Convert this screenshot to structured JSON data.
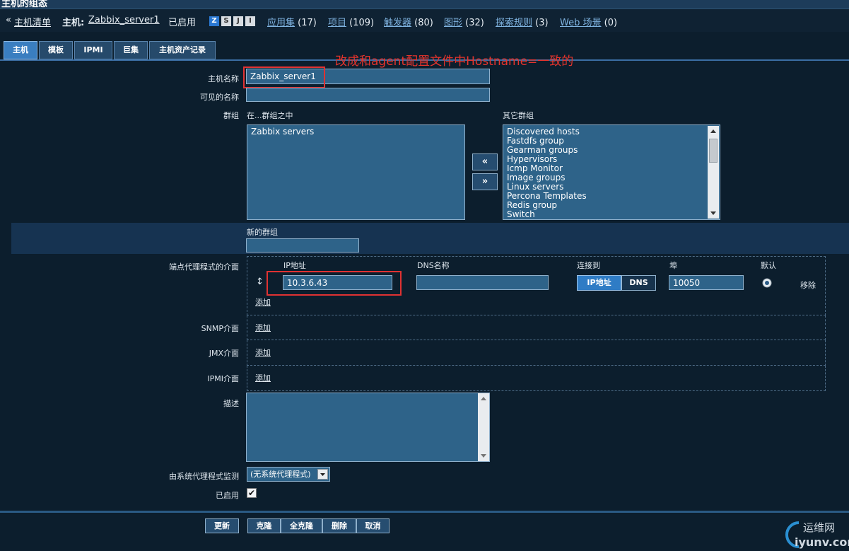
{
  "title": "主机的组态",
  "nav": {
    "back_glyph": "«",
    "host_list": "主机清单",
    "host_prefix": "主机:",
    "host_name": "Zabbix_server1",
    "status": "已启用",
    "badges": [
      "Z",
      "S",
      "J",
      "I"
    ],
    "links": [
      {
        "label": "应用集",
        "count": "(17)"
      },
      {
        "label": "项目",
        "count": "(109)"
      },
      {
        "label": "触发器",
        "count": "(80)"
      },
      {
        "label": "图形",
        "count": "(32)"
      },
      {
        "label": "探索规则",
        "count": "(3)"
      },
      {
        "label": "Web 场景",
        "count": "(0)"
      }
    ]
  },
  "tabs": [
    "主机",
    "模板",
    "IPMI",
    "巨集",
    "主机资产记录"
  ],
  "annotation": "改成和agent配置文件中Hostname=一致的",
  "form": {
    "host_name_label": "主机名称",
    "host_name_value": "Zabbix_server1",
    "visible_name_label": "可见的名称",
    "visible_name_value": "",
    "groups_label": "群组",
    "in_groups_label": "在...群组之中",
    "in_groups": [
      "Zabbix servers"
    ],
    "other_groups_label": "其它群组",
    "other_groups": [
      "Discovered hosts",
      "Fastdfs group",
      "Gearman groups",
      "Hypervisors",
      "Icmp Monitor",
      "Image groups",
      "Linux servers",
      "Percona Templates",
      "Redis group",
      "Switch"
    ],
    "move_left": "«",
    "move_right": "»",
    "new_group_label": "新的群组",
    "new_group_value": "",
    "agent_label": "端点代理程式的介面",
    "col_ip": "IP地址",
    "col_dns": "DNS名称",
    "col_connect": "连接到",
    "col_port": "埠",
    "col_default": "默认",
    "drag_glyph": "↕",
    "ip_value": "10.3.6.43",
    "dns_value": "",
    "connect_ip": "IP地址",
    "connect_dns": "DNS",
    "port_value": "10050",
    "remove": "移除",
    "add": "添加",
    "snmp_label": "SNMP介面",
    "jmx_label": "JMX介面",
    "ipmi_label": "IPMI介面",
    "description_label": "描述",
    "description_value": "",
    "proxy_label": "由系统代理程式监测",
    "proxy_value": "(无系统代理程式)",
    "enabled_label": "已启用",
    "enabled_check": "✔"
  },
  "buttons": [
    "更新",
    "克隆",
    "全克隆",
    "删除",
    "取消"
  ],
  "watermark": {
    "text": "运维网",
    "url": "iyunv.com"
  }
}
